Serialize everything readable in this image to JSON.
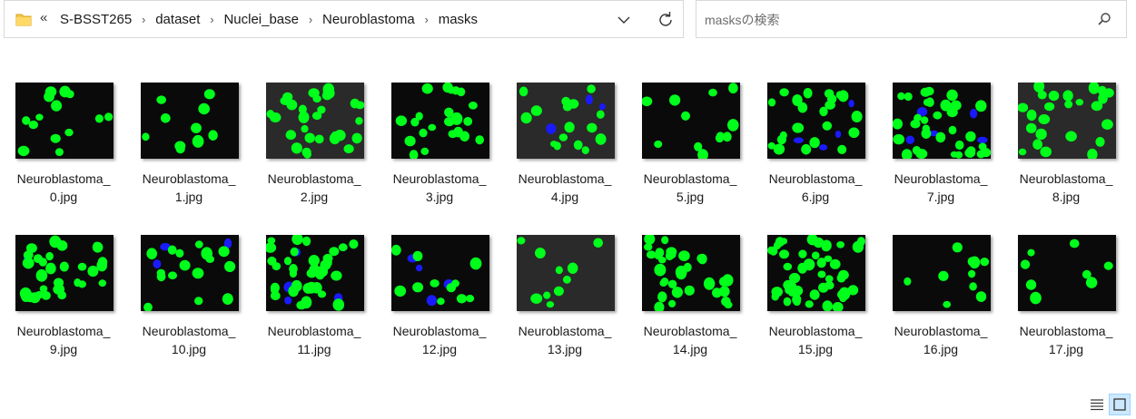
{
  "address_bar": {
    "overflow_glyph": "«",
    "crumbs": [
      "S-BSST265",
      "dataset",
      "Nuclei_base",
      "Neuroblastoma",
      "masks"
    ],
    "icons": {
      "folder": "folder-icon",
      "separator": "chevron-right-icon",
      "dropdown": "chevron-down-icon",
      "refresh": "refresh-icon"
    }
  },
  "search": {
    "placeholder": "masksの検索",
    "icon": "search-icon"
  },
  "files": [
    {
      "line1": "Neuroblastoma_",
      "line2": "0.jpg"
    },
    {
      "line1": "Neuroblastoma_",
      "line2": "1.jpg"
    },
    {
      "line1": "Neuroblastoma_",
      "line2": "2.jpg"
    },
    {
      "line1": "Neuroblastoma_",
      "line2": "3.jpg"
    },
    {
      "line1": "Neuroblastoma_",
      "line2": "4.jpg"
    },
    {
      "line1": "Neuroblastoma_",
      "line2": "5.jpg"
    },
    {
      "line1": "Neuroblastoma_",
      "line2": "6.jpg"
    },
    {
      "line1": "Neuroblastoma_",
      "line2": "7.jpg"
    },
    {
      "line1": "Neuroblastoma_",
      "line2": "8.jpg"
    },
    {
      "line1": "Neuroblastoma_",
      "line2": "9.jpg"
    },
    {
      "line1": "Neuroblastoma_",
      "line2": "10.jpg"
    },
    {
      "line1": "Neuroblastoma_",
      "line2": "11.jpg"
    },
    {
      "line1": "Neuroblastoma_",
      "line2": "12.jpg"
    },
    {
      "line1": "Neuroblastoma_",
      "line2": "13.jpg"
    },
    {
      "line1": "Neuroblastoma_",
      "line2": "14.jpg"
    },
    {
      "line1": "Neuroblastoma_",
      "line2": "15.jpg"
    },
    {
      "line1": "Neuroblastoma_",
      "line2": "16.jpg"
    },
    {
      "line1": "Neuroblastoma_",
      "line2": "17.jpg"
    }
  ],
  "status_bar": {
    "view_buttons": [
      "details-view-icon",
      "large-icons-view-icon"
    ],
    "active_view": "large-icons-view-icon"
  },
  "colors": {
    "nuclei": "#00ff1a",
    "background": "#0a0a0a",
    "accent_blue": "#1a1aff",
    "folder": "#f2c94c",
    "selection": "#cce8ff"
  }
}
